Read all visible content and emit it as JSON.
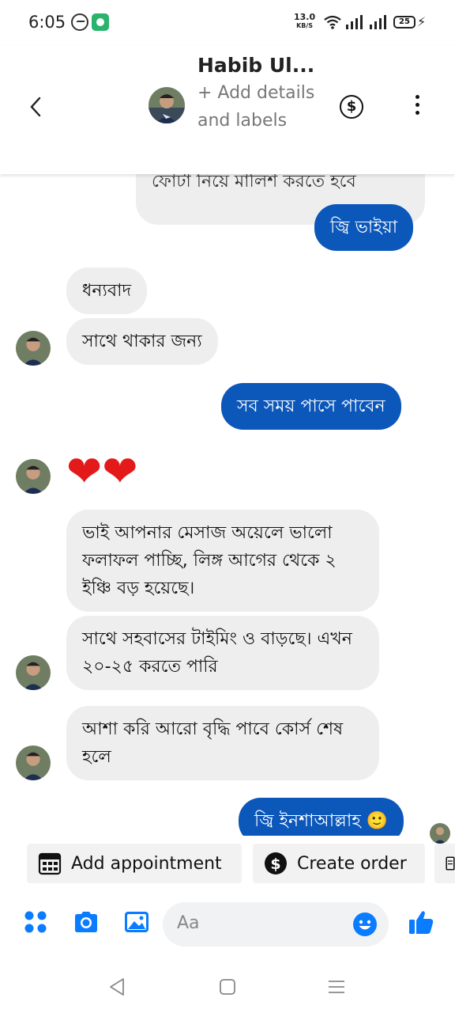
{
  "status_bar": {
    "time": "6:05",
    "net_speed_value": "13.0",
    "net_speed_unit": "KB/S",
    "battery": "25"
  },
  "header": {
    "contact_name": "Habib Ul...",
    "subtitle": "+ Add details and labels"
  },
  "messages": {
    "partial_text": "ফোটা নিয়ে মালিশ করতে হবে",
    "m1": "জ্বি ভাইয়া",
    "m2": "ধন্যবাদ",
    "m3": "সাথে থাকার জন্য",
    "m4": "সব সময় পাসে পাবেন",
    "m5": "❤❤",
    "m6": "ভাই আপনার মেসাজ অয়েলে ভালো ফলাফল পাচ্ছি, লিঙ্গ আগের থেকে ২ ইঞ্চি বড় হয়েছে।",
    "m7": "সাথে সহবাসের টাইমিং ও বাড়ছে। এখন ২০-২৫ করতে পারি",
    "m8": "আশা করি আরো বৃদ্ধি পাবে কোর্স শেষ হলে",
    "m9": "জ্বি ইনশাআল্লাহ 🙂"
  },
  "chips": {
    "add_appointment": "Add appointment",
    "create_order": "Create order"
  },
  "composer": {
    "placeholder": "Aa"
  },
  "colors": {
    "outgoing_bubble": "#0c57ba",
    "incoming_bubble": "#eeeeef",
    "accent_icon": "#0a7cff",
    "heart": "#e21a1a"
  }
}
